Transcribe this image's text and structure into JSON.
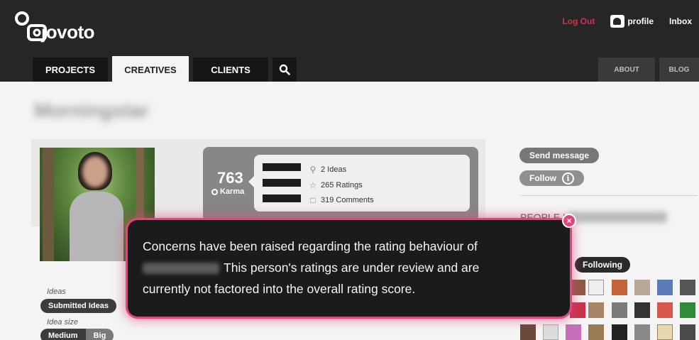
{
  "header": {
    "logo_text": "jovoto",
    "logout": "Log Out",
    "profile": "profile",
    "inbox": "Inbox"
  },
  "nav": {
    "tabs": [
      {
        "label": "PROJECTS",
        "active": false
      },
      {
        "label": "CREATIVES",
        "active": true
      },
      {
        "label": "CLIENTS",
        "active": false
      }
    ],
    "right_tabs": [
      "ABOUT",
      "BLOG"
    ]
  },
  "profile": {
    "username_blurred": "Morningstar",
    "karma_value": "763",
    "karma_label": "Karma",
    "stats": [
      {
        "icon": "idea-icon",
        "text": "2 Ideas"
      },
      {
        "icon": "star-icon",
        "text": "265 Ratings"
      },
      {
        "icon": "comment-icon",
        "text": "319 Comments"
      }
    ]
  },
  "sidebar": {
    "send_message": "Send message",
    "follow": "Follow",
    "people_heading": "PEOPLE I",
    "following": "Following"
  },
  "filters": {
    "ideas_label": "Ideas",
    "submitted_ideas": "Submitted Ideas",
    "idea_size_label": "Idea size",
    "medium": "Medium",
    "big": "Big"
  },
  "modal": {
    "line1": "Concerns have been raised regarding the rating behaviour of",
    "line2": "This person's ratings are under review and are",
    "line3": "currently not factored into the overall rating score."
  },
  "colors": {
    "header_bg": "#262626",
    "logout": "#d2324f",
    "modal_glow": "#e2467c"
  }
}
